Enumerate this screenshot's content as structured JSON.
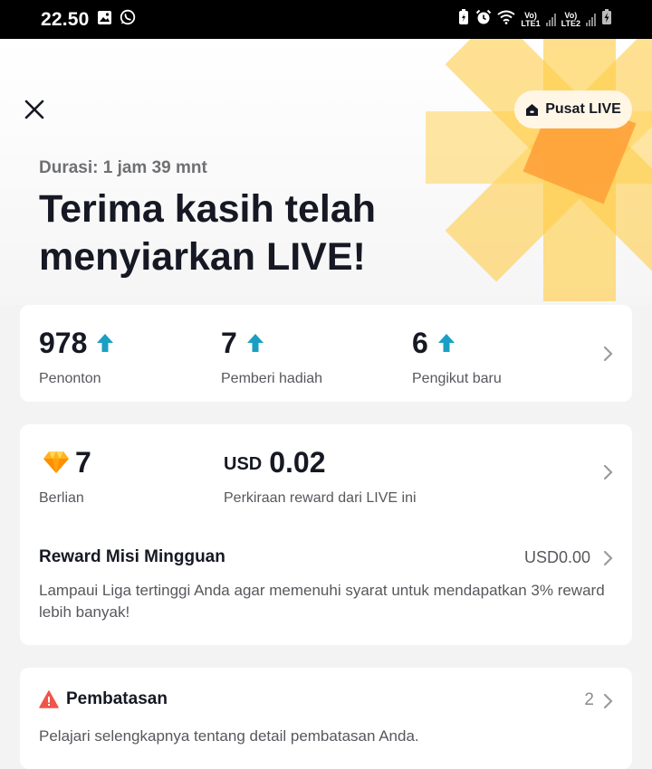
{
  "status_bar": {
    "time": "22.50",
    "net1": "Vo)",
    "net1_sub": "LTE1",
    "net2": "Vo)",
    "net2_sub": "LTE2"
  },
  "header": {
    "live_center_label": "Pusat LIVE",
    "duration": "Durasi: 1 jam 39 mnt",
    "title_line1": "Terima kasih telah",
    "title_line2": "menyiarkan LIVE!"
  },
  "stats": {
    "items": [
      {
        "value": "978",
        "label": "Penonton"
      },
      {
        "value": "7",
        "label": "Pemberi hadiah"
      },
      {
        "value": "6",
        "label": "Pengikut baru"
      }
    ]
  },
  "rewards": {
    "diamonds": {
      "value": "7",
      "label": "Berlian"
    },
    "estimate": {
      "currency": "USD",
      "value": "0.02",
      "label": "Perkiraan reward dari LIVE ini"
    },
    "weekly": {
      "title": "Reward Misi Mingguan",
      "value": "USD0.00",
      "description": "Lampaui Liga tertinggi Anda agar memenuhi syarat untuk mendapatkan 3% reward lebih banyak!"
    }
  },
  "limits": {
    "title": "Pembatasan",
    "count": "2",
    "description": "Pelajari selengkapnya tentang detail pembatasan Anda."
  },
  "colors": {
    "accent_up_arrow": "#1a9fc4",
    "warning": "#f0554b",
    "sun_light": "#ffd86b",
    "sun_dark": "#ff9a2e"
  },
  "icons": [
    "close-icon",
    "live-home-icon",
    "arrow-up-icon",
    "chevron-right-icon",
    "diamond-icon",
    "warning-icon"
  ]
}
